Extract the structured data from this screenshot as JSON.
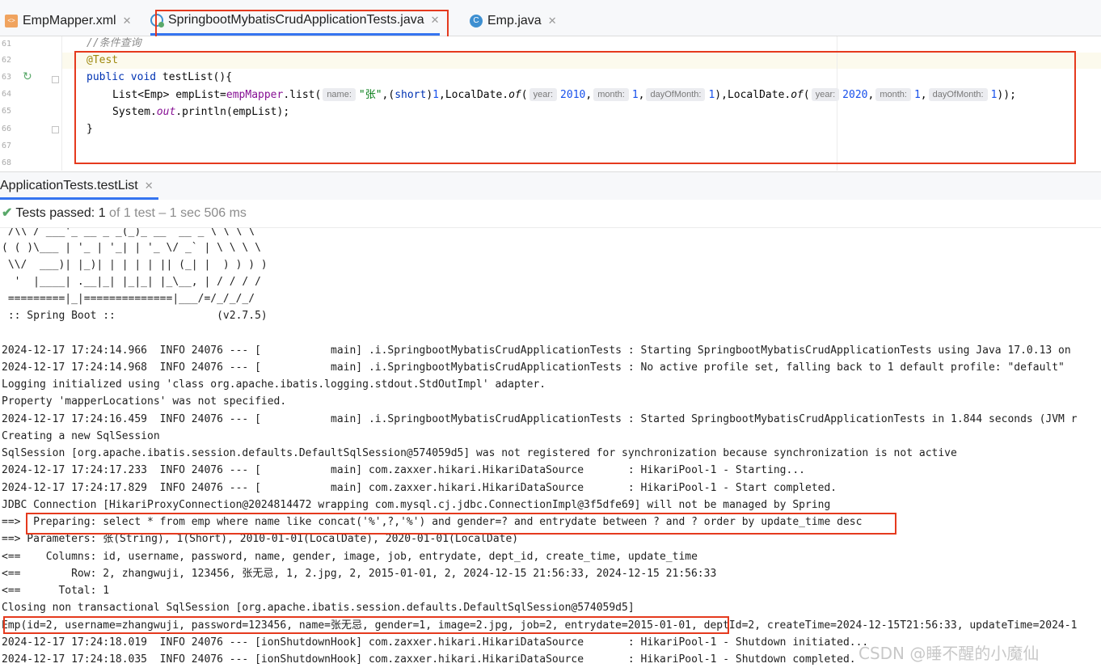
{
  "tabs": [
    {
      "label": "EmpMapper.xml",
      "icon": "xml-file-icon"
    },
    {
      "label": "SpringbootMybatisCrudApplicationTests.java",
      "icon": "junit-class-icon"
    },
    {
      "label": "Emp.java",
      "icon": "class-icon"
    }
  ],
  "editor": {
    "line_numbers": [
      "61",
      "62",
      "63",
      "64",
      "65",
      "66",
      "67",
      "68"
    ],
    "comment": "//条件查询",
    "annotation": "@Test",
    "kw_public": "public",
    "kw_void": "void",
    "method_name": " testList(){",
    "l4_a": "List<Emp> empList=",
    "l4_field": "empMapper",
    "l4_b": ".list(",
    "hint_name": "name:",
    "l4_str": "\"张\"",
    "l4_c": ",(",
    "kw_short": "short",
    "l4_d": ")",
    "num_1": "1",
    "l4_e": ",LocalDate.",
    "of": "of",
    "l4_paren": "(",
    "hint_year": "year:",
    "year1": "2010",
    "comma": ",",
    "hint_month": "month:",
    "month1": "1",
    "hint_day": "dayOfMonth:",
    "day1": "1",
    "l4_f": "),LocalDate.",
    "year2": "2020",
    "month2": "1",
    "day2": "1",
    "l4_end": "));",
    "l5_a": "System.",
    "l5_out": "out",
    "l5_b": ".println(empList);",
    "close_brace": "}"
  },
  "run_panel": {
    "tab_label": "ApplicationTests.testList",
    "status_prefix": "Tests passed:",
    "status_count": "1",
    "status_rest": "of 1 test – 1 sec 506 ms"
  },
  "console_lines": [
    " /\\\\ / ___'_ __ _ _(_)_ __  __ _ \\ \\ \\ \\",
    "( ( )\\___ | '_ | '_| | '_ \\/ _` | \\ \\ \\ \\",
    " \\\\/  ___)| |_)| | | | | || (_| |  ) ) ) )",
    "  '  |____| .__|_| |_|_| |_\\__, | / / / /",
    " =========|_|==============|___/=/_/_/_/",
    " :: Spring Boot ::                (v2.7.5)",
    "",
    "2024-12-17 17:24:14.966  INFO 24076 --- [           main] .i.SpringbootMybatisCrudApplicationTests : Starting SpringbootMybatisCrudApplicationTests using Java 17.0.13 on",
    "2024-12-17 17:24:14.968  INFO 24076 --- [           main] .i.SpringbootMybatisCrudApplicationTests : No active profile set, falling back to 1 default profile: \"default\"",
    "Logging initialized using 'class org.apache.ibatis.logging.stdout.StdOutImpl' adapter.",
    "Property 'mapperLocations' was not specified.",
    "2024-12-17 17:24:16.459  INFO 24076 --- [           main] .i.SpringbootMybatisCrudApplicationTests : Started SpringbootMybatisCrudApplicationTests in 1.844 seconds (JVM r",
    "Creating a new SqlSession",
    "SqlSession [org.apache.ibatis.session.defaults.DefaultSqlSession@574059d5] was not registered for synchronization because synchronization is not active",
    "2024-12-17 17:24:17.233  INFO 24076 --- [           main] com.zaxxer.hikari.HikariDataSource       : HikariPool-1 - Starting...",
    "2024-12-17 17:24:17.829  INFO 24076 --- [           main] com.zaxxer.hikari.HikariDataSource       : HikariPool-1 - Start completed.",
    "JDBC Connection [HikariProxyConnection@2024814472 wrapping com.mysql.cj.jdbc.ConnectionImpl@3f5dfe69] will not be managed by Spring",
    "==>  Preparing: select * from emp where name like concat('%',?,'%') and gender=? and entrydate between ? and ? order by update_time desc",
    "==> Parameters: 张(String), 1(Short), 2010-01-01(LocalDate), 2020-01-01(LocalDate)",
    "<==    Columns: id, username, password, name, gender, image, job, entrydate, dept_id, create_time, update_time",
    "<==        Row: 2, zhangwuji, 123456, 张无忌, 1, 2.jpg, 2, 2015-01-01, 2, 2024-12-15 21:56:33, 2024-12-15 21:56:33",
    "<==      Total: 1",
    "Closing non transactional SqlSession [org.apache.ibatis.session.defaults.DefaultSqlSession@574059d5]",
    "Emp(id=2, username=zhangwuji, password=123456, name=张无忌, gender=1, image=2.jpg, job=2, entrydate=2015-01-01, deptId=2, createTime=2024-12-15T21:56:33, updateTime=2024-1",
    "2024-12-17 17:24:18.019  INFO 24076 --- [ionShutdownHook] com.zaxxer.hikari.HikariDataSource       : HikariPool-1 - Shutdown initiated...",
    "2024-12-17 17:24:18.035  INFO 24076 --- [ionShutdownHook] com.zaxxer.hikari.HikariDataSource       : HikariPool-1 - Shutdown completed."
  ],
  "watermark": "CSDN @睡不醒的小魔仙"
}
